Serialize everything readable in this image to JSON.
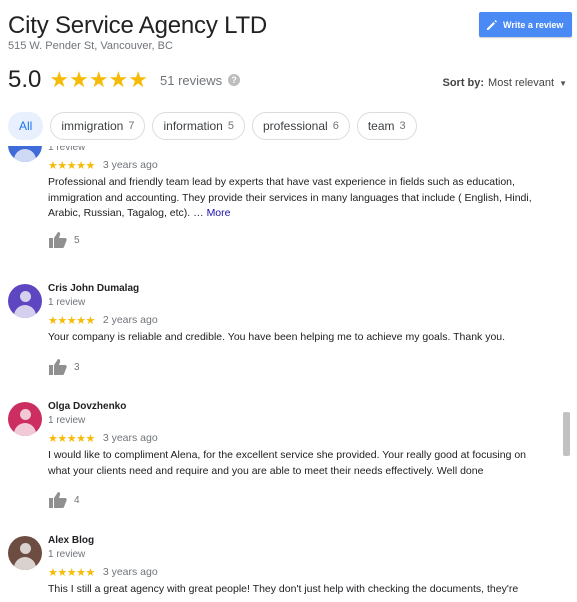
{
  "business": {
    "name": "City Service Agency LTD",
    "address": "515 W. Pender St, Vancouver, BC"
  },
  "write_review": {
    "label": "Write a review",
    "icon": "pencil-icon"
  },
  "rating": {
    "value": "5.0",
    "stars": "★★★★★",
    "stars_count": 5,
    "reviews_label": "51 reviews",
    "help": "?"
  },
  "sort": {
    "label": "Sort by:",
    "value": "Most relevant"
  },
  "chips": [
    {
      "label": "All",
      "count": "",
      "active": true
    },
    {
      "label": "immigration",
      "count": "7"
    },
    {
      "label": "information",
      "count": "5"
    },
    {
      "label": "professional",
      "count": "6"
    },
    {
      "label": "team",
      "count": "3"
    }
  ],
  "reviews": [
    {
      "name": "",
      "meta": "1 review",
      "stars": "★★★★★",
      "age": "3 years ago",
      "text": "Professional and friendly team lead by experts that have vast experience in fields such as education, immigration and accounting. They provide their services in many languages that include ( English, Hindi, Arabic, Russian, Tagalog, etc). …",
      "more": "More",
      "likes": "5",
      "avatar_color": "#3f6bd8"
    },
    {
      "name": "Cris John Dumalag",
      "meta": "1 review",
      "stars": "★★★★★",
      "age": "2 years ago",
      "text": "Your company is reliable and credible. You have been helping me to achieve my goals. Thank you.",
      "likes": "3",
      "avatar_color": "#5d46c0"
    },
    {
      "name": "Olga Dovzhenko",
      "meta": "1 review",
      "stars": "★★★★★",
      "age": "3 years ago",
      "text": "I would like to compliment Alena, for the excellent service she provided. Your really good at focusing on what your clients need and require and you are able to meet their needs effectively. Well done",
      "likes": "4",
      "avatar_color": "#cc2e62"
    },
    {
      "name": "Alex Blog",
      "meta": "1 review",
      "stars": "★★★★★",
      "age": "3 years ago",
      "text": "This I still a great agency with great people! They don't just help with checking the documents, they're",
      "avatar_color": "#6d4c41"
    }
  ],
  "colors": {
    "star": "#f6bb06",
    "button": "#4a8af4",
    "link": "#1a0dab",
    "chip_active_bg": "#e8f0fe",
    "chip_active_text": "#1a73e8"
  }
}
